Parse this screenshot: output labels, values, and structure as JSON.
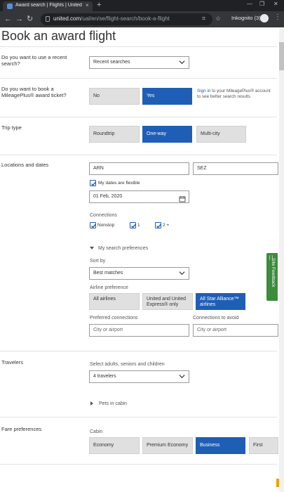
{
  "browser": {
    "tab_title": "Award search | Flights | United Airli",
    "tab_close": "×",
    "new_tab": "+",
    "url_host": "united.com",
    "url_path": "/ual/en/se/flight-search/book-a-flight",
    "incognito_label": "Inkognito (3)",
    "win_minimize": "—",
    "win_restore": "❐",
    "win_close": "✕"
  },
  "page": {
    "title": "Book an award flight"
  },
  "recent_search": {
    "question": "Do you want to use a recent search?",
    "select_value": "Recent searches"
  },
  "award_ticket": {
    "question": "Do you want to book a MileagePlus® award ticket?",
    "no_label": "No",
    "yes_label": "Yes",
    "signin_link": "Sign in",
    "signin_rest": " to your MileagePlus® account to see better search results"
  },
  "trip_type": {
    "label": "Trip type",
    "options": [
      "Roundtrip",
      "One-way",
      "Multi-city"
    ],
    "selected": "One-way"
  },
  "locations": {
    "label": "Locations and dates",
    "from": "ARN",
    "to": "SEZ",
    "flexible_label": "My dates are flexible",
    "date": "01 Feb, 2020",
    "connections_label": "Connections",
    "connections": [
      "Nonstop",
      "1",
      "2 +"
    ]
  },
  "preferences": {
    "toggle_label": "My search preferences",
    "sort_label": "Sort by",
    "sort_value": "Best matches",
    "airline_label": "Airline preference",
    "airline_options": [
      "All airlines",
      "United and United Express® only",
      "All Star Alliance™ airlines"
    ],
    "airline_selected": "All Star Alliance™ airlines",
    "preferred_label": "Preferred connections",
    "preferred_placeholder": "City or airport",
    "avoid_label": "Connections to avoid",
    "avoid_placeholder": "City or airport"
  },
  "travelers": {
    "label": "Travelers",
    "select_label": "Select adults, seniors and children",
    "select_value": "4 travelers",
    "pets_label": "Pets in cabin"
  },
  "fare": {
    "label": "Fare preferences",
    "cabin_label": "Cabin",
    "cabin_options": [
      "Economy",
      "Premium Economy",
      "Business",
      "First"
    ],
    "cabin_selected": "Business"
  },
  "feedback": {
    "label": "Site Feedback"
  },
  "colors": {
    "accent": "#1f5eb5",
    "option_bg": "#e0e0e0",
    "feedback": "#3c8c3c"
  }
}
